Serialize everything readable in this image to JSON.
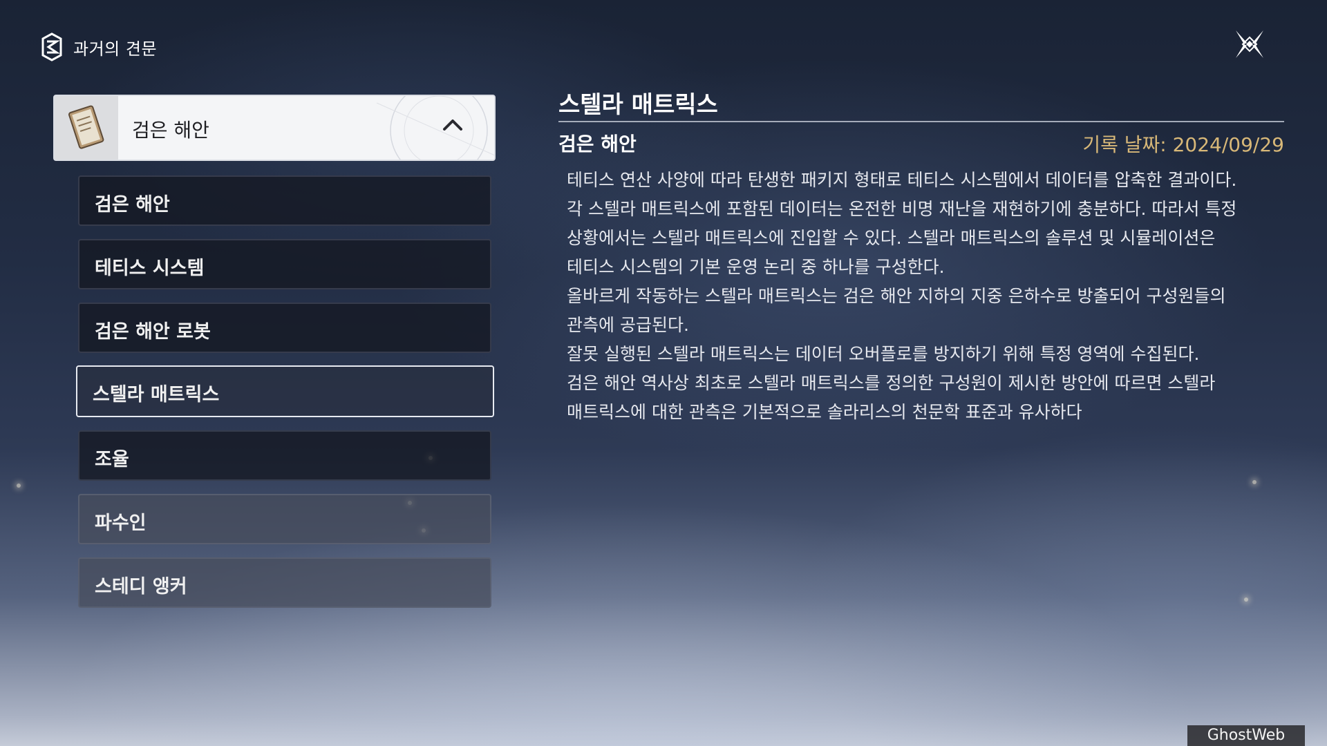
{
  "header": {
    "title": "과거의 견문"
  },
  "category": {
    "label": "검은 해안"
  },
  "list": {
    "items": [
      {
        "label": "검은 해안"
      },
      {
        "label": "테티스 시스템"
      },
      {
        "label": "검은 해안 로봇"
      },
      {
        "label": "스텔라 매트릭스"
      },
      {
        "label": "조율"
      },
      {
        "label": "파수인"
      },
      {
        "label": "스테디 앵커"
      }
    ],
    "selected_index": 3
  },
  "detail": {
    "title": "스텔라 매트릭스",
    "subtitle": "검은 해안",
    "date": "기록 날짜: 2024/09/29",
    "lines": [
      "테티스 연산 사양에 따라 탄생한 패키지 형태로 테티스 시스템에서 데이터를 압축한 결과이다.",
      "각 스텔라 매트릭스에 포함된 데이터는 온전한 비명 재난을 재현하기에 충분하다. 따라서 특정",
      "상황에서는 스텔라 매트릭스에  진입할 수 있다. 스텔라 매트릭스의 솔루션 및 시뮬레이션은",
      "테티스 시스템의 기본 운영 논리 중 하나를 구성한다.",
      "올바르게 작동하는 스텔라 매트릭스는 검은 해안 지하의 지중 은하수로 방출되어 구성원들의",
      "관측에 공급된다.",
      "잘못 실행된 스텔라 매트릭스는 데이터 오버플로를 방지하기 위해 특정 영역에 수집된다.",
      "검은 해안 역사상 최초로 스텔라 매트릭스를 정의한 구성원이 제시한 방안에 따르면 스텔라",
      "매트릭스에 대한 관측은 기본적으로 솔라리스의 천문학 표준과 유사하다"
    ]
  },
  "watermark": "GhostWeb",
  "colors": {
    "accent_date": "#d8b878",
    "selected_border": "#e8ebf2"
  },
  "icons": {
    "logo": "hexagon-logo-icon",
    "close": "close-icon",
    "chevron": "chevron-up-icon",
    "book": "book-icon"
  }
}
